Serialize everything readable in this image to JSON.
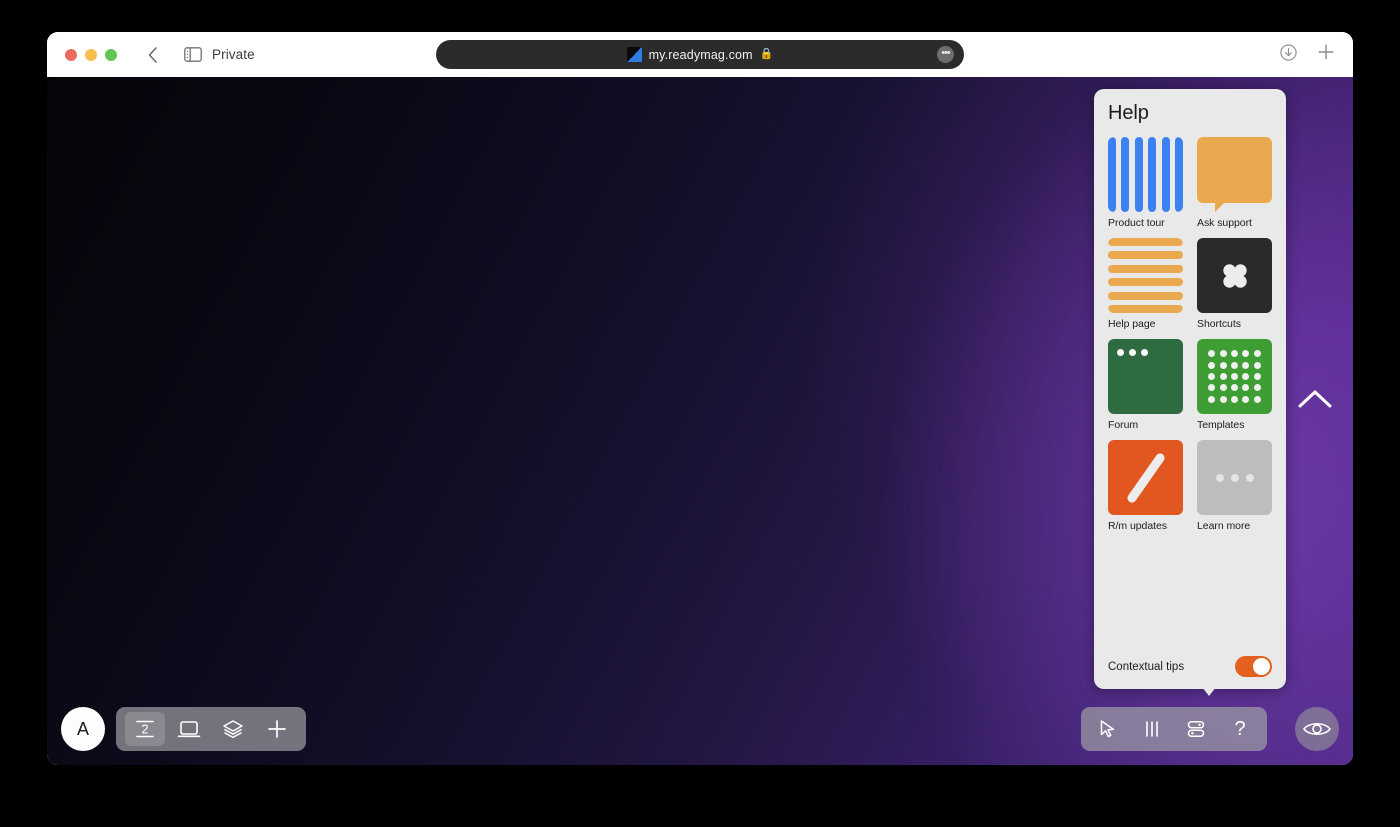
{
  "browser": {
    "private_label": "Private",
    "url": "my.readymag.com",
    "lock_icon": "lock-icon",
    "back_icon": "chevron-left-icon",
    "sidebar_icon": "sidebar-toggle-icon",
    "more_icon": "ellipsis-icon",
    "download_icon": "download-icon",
    "new_tab_icon": "plus-icon"
  },
  "help_panel": {
    "title": "Help",
    "tiles": [
      {
        "label": "Product tour",
        "art": "vbars",
        "icon_name": "product-tour-icon",
        "color": "#3b82f0"
      },
      {
        "label": "Ask support",
        "art": "bubble",
        "icon_name": "ask-support-icon",
        "color": "#eaa94e"
      },
      {
        "label": "Help page",
        "art": "hbars",
        "icon_name": "help-page-icon",
        "color": "#eaa94e"
      },
      {
        "label": "Shortcuts",
        "art": "shortcuts",
        "icon_name": "shortcuts-icon",
        "color": "#2a2a2a"
      },
      {
        "label": "Forum",
        "art": "forum",
        "icon_name": "forum-icon",
        "color": "#2e6b41"
      },
      {
        "label": "Templates",
        "art": "templates",
        "icon_name": "templates-icon",
        "color": "#3f9e33"
      },
      {
        "label": "R/m updates",
        "art": "updates",
        "icon_name": "updates-icon",
        "color": "#e1571f"
      },
      {
        "label": "Learn more",
        "art": "learn",
        "icon_name": "learn-more-icon",
        "color": "#bdbdbd"
      }
    ],
    "contextual_tips": {
      "label": "Contextual tips",
      "enabled": true,
      "accent": "#e4601f"
    }
  },
  "canvas": {
    "chevron_marker_icon": "chevron-up-icon",
    "background_from": "#050509",
    "background_to": "#4a2780"
  },
  "left_toolbar": {
    "avatar_letter": "A",
    "items": [
      {
        "icon_name": "typography-icon",
        "label": "2",
        "active": true
      },
      {
        "icon_name": "screen-icon",
        "label": "",
        "active": false
      },
      {
        "icon_name": "layers-icon",
        "label": "",
        "active": false
      },
      {
        "icon_name": "plus-icon",
        "label": "",
        "active": false
      }
    ]
  },
  "right_toolbar": {
    "items": [
      {
        "icon_name": "cursor-icon",
        "label": ""
      },
      {
        "icon_name": "columns-icon",
        "label": ""
      },
      {
        "icon_name": "settings-icon",
        "label": ""
      },
      {
        "icon_name": "question-icon",
        "label": "?"
      }
    ],
    "preview": {
      "icon_name": "eye-icon"
    }
  }
}
